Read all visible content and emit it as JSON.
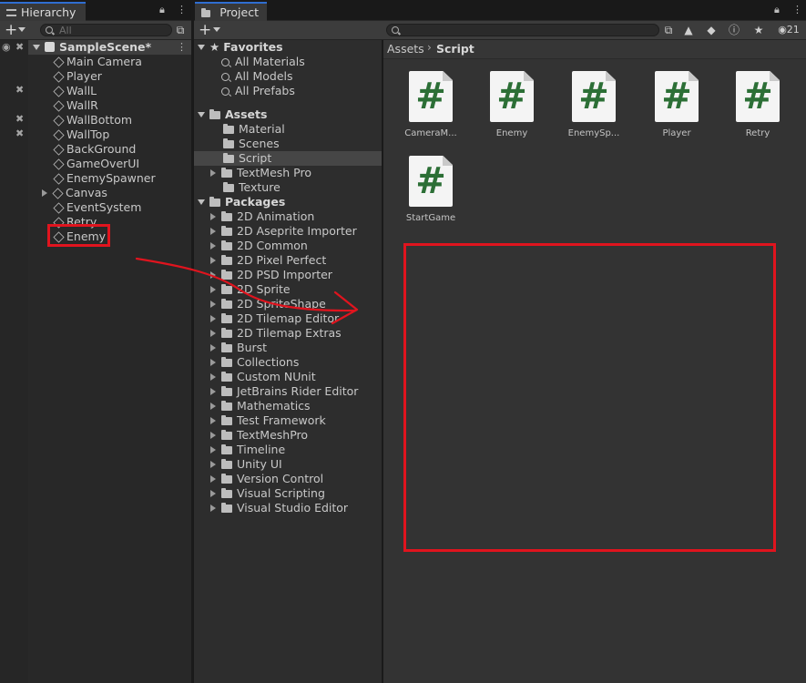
{
  "hierarchy": {
    "tab_label": "Hierarchy",
    "search_placeholder": "All",
    "scene_name": "SampleScene*",
    "items": [
      {
        "label": "Main Camera"
      },
      {
        "label": "Player"
      },
      {
        "label": "WallL"
      },
      {
        "label": "WallR"
      },
      {
        "label": "WallBottom"
      },
      {
        "label": "WallTop"
      },
      {
        "label": "BackGround"
      },
      {
        "label": "GameOverUI"
      },
      {
        "label": "EnemySpawner"
      },
      {
        "label": "Canvas"
      },
      {
        "label": "EventSystem"
      },
      {
        "label": "Retry"
      },
      {
        "label": "Enemy"
      }
    ]
  },
  "project": {
    "tab_label": "Project",
    "toolbar_badge": "21",
    "favorites": {
      "label": "Favorites",
      "items": [
        {
          "label": "All Materials"
        },
        {
          "label": "All Models"
        },
        {
          "label": "All Prefabs"
        }
      ]
    },
    "assets": {
      "label": "Assets",
      "items": [
        {
          "label": "Material"
        },
        {
          "label": "Scenes"
        },
        {
          "label": "Script"
        },
        {
          "label": "TextMesh Pro"
        },
        {
          "label": "Texture"
        }
      ]
    },
    "packages": {
      "label": "Packages",
      "items": [
        {
          "label": "2D Animation"
        },
        {
          "label": "2D Aseprite Importer"
        },
        {
          "label": "2D Common"
        },
        {
          "label": "2D Pixel Perfect"
        },
        {
          "label": "2D PSD Importer"
        },
        {
          "label": "2D Sprite"
        },
        {
          "label": "2D SpriteShape"
        },
        {
          "label": "2D Tilemap Editor"
        },
        {
          "label": "2D Tilemap Extras"
        },
        {
          "label": "Burst"
        },
        {
          "label": "Collections"
        },
        {
          "label": "Custom NUnit"
        },
        {
          "label": "JetBrains Rider Editor"
        },
        {
          "label": "Mathematics"
        },
        {
          "label": "Test Framework"
        },
        {
          "label": "TextMeshPro"
        },
        {
          "label": "Timeline"
        },
        {
          "label": "Unity UI"
        },
        {
          "label": "Version Control"
        },
        {
          "label": "Visual Scripting"
        },
        {
          "label": "Visual Studio Editor"
        }
      ]
    },
    "breadcrumb": {
      "root": "Assets",
      "current": "Script"
    },
    "assets_grid": [
      {
        "label": "CameraM...",
        "glyph": "#"
      },
      {
        "label": "Enemy",
        "glyph": "#"
      },
      {
        "label": "EnemySp...",
        "glyph": "#"
      },
      {
        "label": "Player",
        "glyph": "#"
      },
      {
        "label": "Retry",
        "glyph": "#"
      },
      {
        "label": "StartGame",
        "glyph": "#"
      }
    ]
  },
  "colors": {
    "annotation_red": "#e0141e",
    "script_hash_green": "#2c6f36",
    "selection": "#3e3e3e",
    "tab_accent": "#2f6ed1"
  }
}
